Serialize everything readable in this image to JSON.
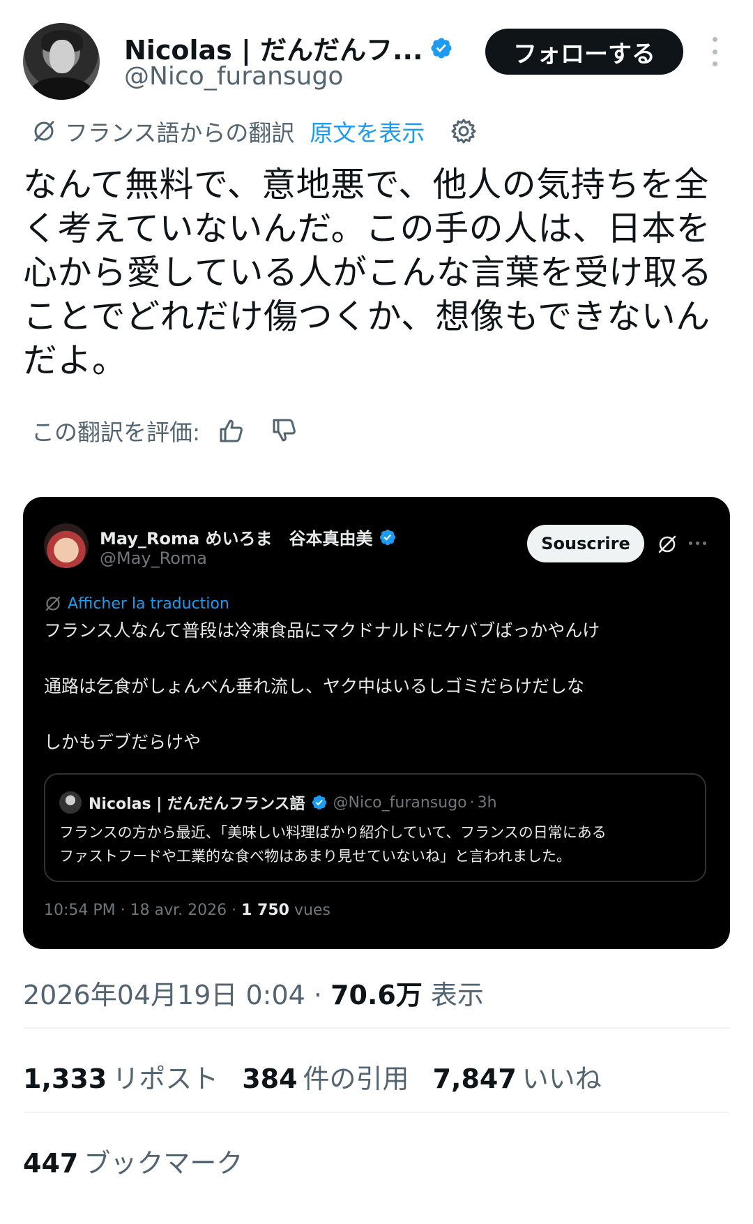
{
  "author": {
    "name": "Nicolas | だんだんフ...",
    "handle": "@Nico_furansugo",
    "follow_label": "フォローする"
  },
  "translation": {
    "label": "フランス語からの翻訳",
    "show_original": "原文を表示"
  },
  "tweet_text": "なんて無料で、意地悪で、他人の気持ちを全く考えていないんだ。この手の人は、日本を心から愛している人がこんな言葉を受け取ることでどれだけ傷つくか、想像もできないんだよ。",
  "rate": {
    "label": "この翻訳を評価:"
  },
  "embed": {
    "name": "May_Roma めいろま　谷本真由美",
    "handle": "@May_Roma",
    "subscribe_label": "Souscrire",
    "translate_label": "Afficher la traduction",
    "lines": [
      "フランス人なんて普段は冷凍食品にマクドナルドにケバブばっかやんけ",
      "",
      "通路は乞食がしょんべん垂れ流し、ヤク中はいるしゴミだらけだしな",
      "",
      "しかもデブだらけや"
    ],
    "quote": {
      "name": "Nicolas | だんだんフランス語",
      "handle": "@Nico_furansugo",
      "time": "3h",
      "lines": [
        "フランスの方から最近、「美味しい料理ばかり紹介していて、フランスの日常にある",
        "ファストフードや工業的な食べ物はあまり見せていないね」と言われました。"
      ]
    },
    "meta_time": "10:54 PM · 18 avr. 2026 · ",
    "meta_views_num": "1 750",
    "meta_views_label": " vues"
  },
  "timestamp": {
    "date": "2026年04月19日 0:04 · ",
    "views_num": "70.6万",
    "views_label": " 表示"
  },
  "stats": {
    "reposts_num": "1,333",
    "reposts_label": "リポスト",
    "quotes_num": "384",
    "quotes_label": "件の引用",
    "likes_num": "7,847",
    "likes_label": "いいね",
    "bookmarks_num": "447",
    "bookmarks_label": "ブックマーク"
  },
  "colors": {
    "accent": "#1d9bf0",
    "text": "#0f1419",
    "secondary": "#536471"
  },
  "icons": [
    "verified-badge-icon",
    "grok-translate-icon",
    "gear-icon",
    "thumbs-up-icon",
    "thumbs-down-icon",
    "more-vertical-icon",
    "more-horizontal-icon"
  ]
}
